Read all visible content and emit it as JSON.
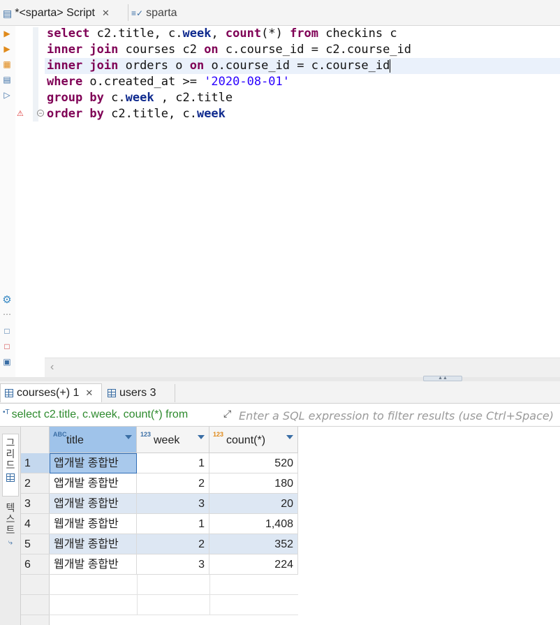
{
  "editor_tabs": [
    {
      "label": "*<sparta> Script",
      "icon": "script-icon",
      "active": true
    },
    {
      "label": "sparta",
      "icon": "connection-icon",
      "active": false
    }
  ],
  "sql_lines": [
    [
      [
        "kw",
        "select"
      ],
      [
        "t",
        " c2.title, c."
      ],
      [
        "col",
        "week"
      ],
      [
        "t",
        ", "
      ],
      [
        "kw",
        "count"
      ],
      [
        "t",
        "(*) "
      ],
      [
        "kw",
        "from"
      ],
      [
        "t",
        " checkins c"
      ]
    ],
    [
      [
        "kw",
        "inner join"
      ],
      [
        "t",
        " courses c2 "
      ],
      [
        "kw",
        "on"
      ],
      [
        "t",
        " c.course_id = c2.course_id"
      ]
    ],
    [
      [
        "kw",
        "inner join"
      ],
      [
        "t",
        " orders o "
      ],
      [
        "kw",
        "on"
      ],
      [
        "t",
        " o.course_id = c.course_id"
      ]
    ],
    [
      [
        "kw",
        "where"
      ],
      [
        "t",
        " o.created_at >= "
      ],
      [
        "str",
        "'2020-08-01'"
      ]
    ],
    [
      [
        "kw",
        "group by"
      ],
      [
        "t",
        " c."
      ],
      [
        "col",
        "week"
      ],
      [
        "t",
        " , c2.title"
      ]
    ],
    [
      [
        "kw",
        "order by"
      ],
      [
        "t",
        " c2.title, c."
      ],
      [
        "col",
        "week"
      ]
    ]
  ],
  "result_tabs": [
    {
      "label": "courses(+) 1",
      "active": true
    },
    {
      "label": "users 3",
      "active": false
    }
  ],
  "filter": {
    "query_text": "select c2.title, c.week, count(*) from",
    "placeholder": "Enter a SQL expression to filter results (use Ctrl+Space)"
  },
  "side_tabs": {
    "grid": "그리드",
    "text": "텍스트"
  },
  "columns": [
    {
      "label": "title",
      "type": "ABC"
    },
    {
      "label": "week",
      "type": "123"
    },
    {
      "label": "count(*)",
      "type": "123"
    }
  ],
  "rows": [
    {
      "num": "1",
      "title": "앱개발 종합반",
      "week": "1",
      "count": "520"
    },
    {
      "num": "2",
      "title": "앱개발 종합반",
      "week": "2",
      "count": "180"
    },
    {
      "num": "3",
      "title": "앱개발 종합반",
      "week": "3",
      "count": "20"
    },
    {
      "num": "4",
      "title": "웹개발 종합반",
      "week": "1",
      "count": "1,408"
    },
    {
      "num": "5",
      "title": "웹개발 종합반",
      "week": "2",
      "count": "352"
    },
    {
      "num": "6",
      "title": "웹개발 종합반",
      "week": "3",
      "count": "224"
    }
  ]
}
